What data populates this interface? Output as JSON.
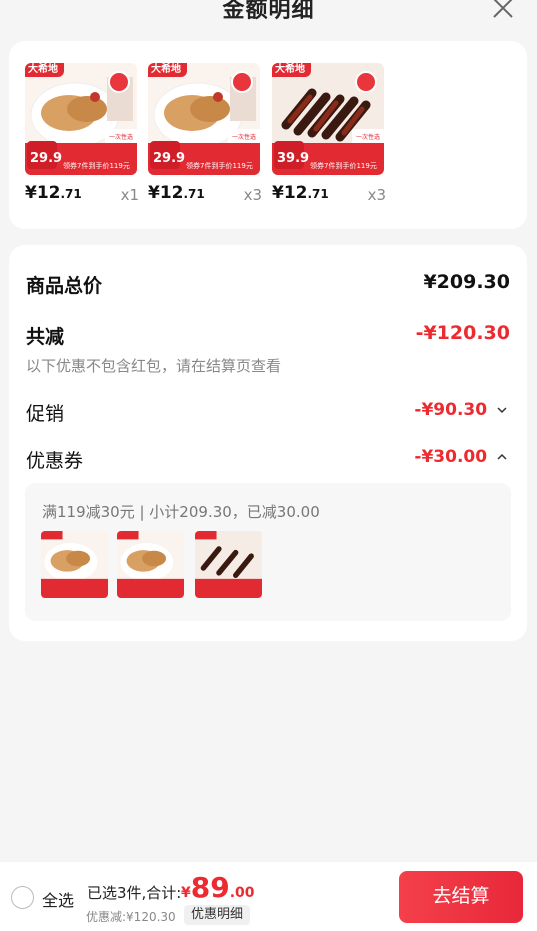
{
  "header": {
    "title": "金额明细"
  },
  "items": [
    {
      "brand": "大希地",
      "promo_price": "29.9",
      "promo_text": "领券7件到手价119元",
      "badge": "一次性选",
      "price_main": "¥12",
      "price_dec": ".71",
      "qty": "x1",
      "kind": "chicken"
    },
    {
      "brand": "大希地",
      "promo_price": "29.9",
      "promo_text": "领券7件到手价119元",
      "badge": "一次性选",
      "price_main": "¥12",
      "price_dec": ".71",
      "qty": "x3",
      "kind": "chicken"
    },
    {
      "brand": "大希地",
      "promo_price": "39.9",
      "promo_text": "领券7件到手价119元",
      "badge": "一次性选",
      "price_main": "¥12",
      "price_dec": ".71",
      "qty": "x3",
      "kind": "skewer"
    }
  ],
  "summary": {
    "total_label": "商品总价",
    "total_value": "¥209.30",
    "reduce_label": "共减",
    "reduce_value": "-¥120.30",
    "note": "以下优惠不包含红包，请在结算页查看",
    "promo_label": "促销",
    "promo_value": "-¥90.30",
    "coupon_label": "优惠券",
    "coupon_value": "-¥30.00",
    "coupon_detail": "满119减30元 | 小计209.30，已减30.00"
  },
  "bottom": {
    "select_all": "全选",
    "selected_text": "已选3件,合计:",
    "currency": "¥",
    "total_int": "89",
    "total_dec": ".00",
    "discount_text": "优惠减:¥120.30",
    "detail_button": "优惠明细",
    "checkout_button": "去结算"
  },
  "colors": {
    "accent": "#ec2a2f",
    "brand_red": "#e22a32"
  }
}
